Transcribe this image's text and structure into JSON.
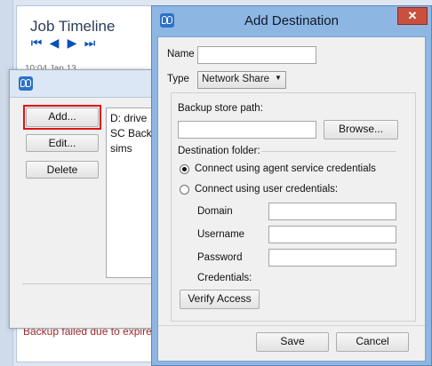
{
  "background": {
    "title": "Job Timeline",
    "clipped_text": "10:04 Jan 13",
    "error_text": "Backup failed due to expire"
  },
  "middle_window": {
    "buttons": {
      "add": "Add...",
      "edit": "Edit...",
      "delete": "Delete"
    },
    "list": [
      "D: drive",
      "SC Backu",
      "sims"
    ]
  },
  "dialog": {
    "title": "Add Destination",
    "close_glyph": "✕",
    "name_label": "Name",
    "name_value": "",
    "type_label": "Type",
    "type_value": "Network Share",
    "backup_path_label": "Backup store path:",
    "backup_path_value": "",
    "browse_label": "Browse...",
    "dest_folder_label": "Destination folder:",
    "radio_agent": "Connect using agent service credentials",
    "radio_user": "Connect using user credentials:",
    "domain_label": "Domain",
    "username_label": "Username",
    "password_label": "Password",
    "credentials_label": "Credentials:",
    "verify_label": "Verify Access",
    "save_label": "Save",
    "cancel_label": "Cancel"
  }
}
